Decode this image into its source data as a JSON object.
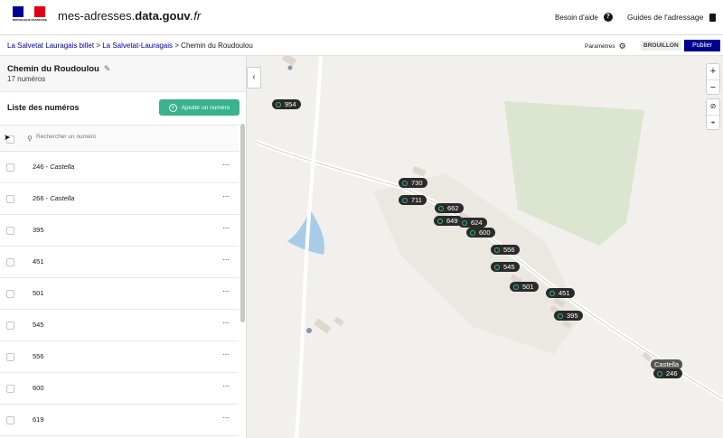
{
  "header": {
    "logo_text": "RÉPUBLIQUE FRANÇAISE",
    "brand_prefix": "mes-adresses.",
    "brand_bold": "data.gouv",
    "brand_suffix": ".fr",
    "help_label": "Besoin d'aide",
    "guides_label": "Guides de l'adressage"
  },
  "breadcrumb": {
    "commune": "La Salvetat Lauragais billet",
    "separator": ">",
    "base": "La Salvetat-Lauragais",
    "current": "Chemin du Roudoulou"
  },
  "actions": {
    "params_label": "Paramètres",
    "status_badge": "BROUILLON",
    "publish_label": "Publier"
  },
  "street": {
    "name": "Chemin du Roudoulou",
    "count": "17 numéros"
  },
  "list": {
    "title": "Liste des numéros",
    "add_label": "Ajouter un numéro",
    "search_placeholder": "Rechercher un numéro",
    "rows": [
      {
        "number": "246",
        "toponyme": "Castella"
      },
      {
        "number": "266",
        "toponyme": "Castella"
      },
      {
        "number": "395",
        "toponyme": ""
      },
      {
        "number": "451",
        "toponyme": ""
      },
      {
        "number": "501",
        "toponyme": ""
      },
      {
        "number": "545",
        "toponyme": ""
      },
      {
        "number": "556",
        "toponyme": ""
      },
      {
        "number": "600",
        "toponyme": ""
      },
      {
        "number": "619",
        "toponyme": ""
      }
    ],
    "row_menu": "···"
  },
  "map": {
    "zoom_in": "+",
    "zoom_out": "−",
    "markers": [
      "954",
      "730",
      "711",
      "662",
      "649",
      "624",
      "600",
      "556",
      "545",
      "501",
      "451",
      "395",
      "246"
    ],
    "toponym_label": "Castella",
    "collapse_icon": "‹"
  },
  "colors": {
    "primary": "#000091",
    "accent": "#3ab28d"
  }
}
